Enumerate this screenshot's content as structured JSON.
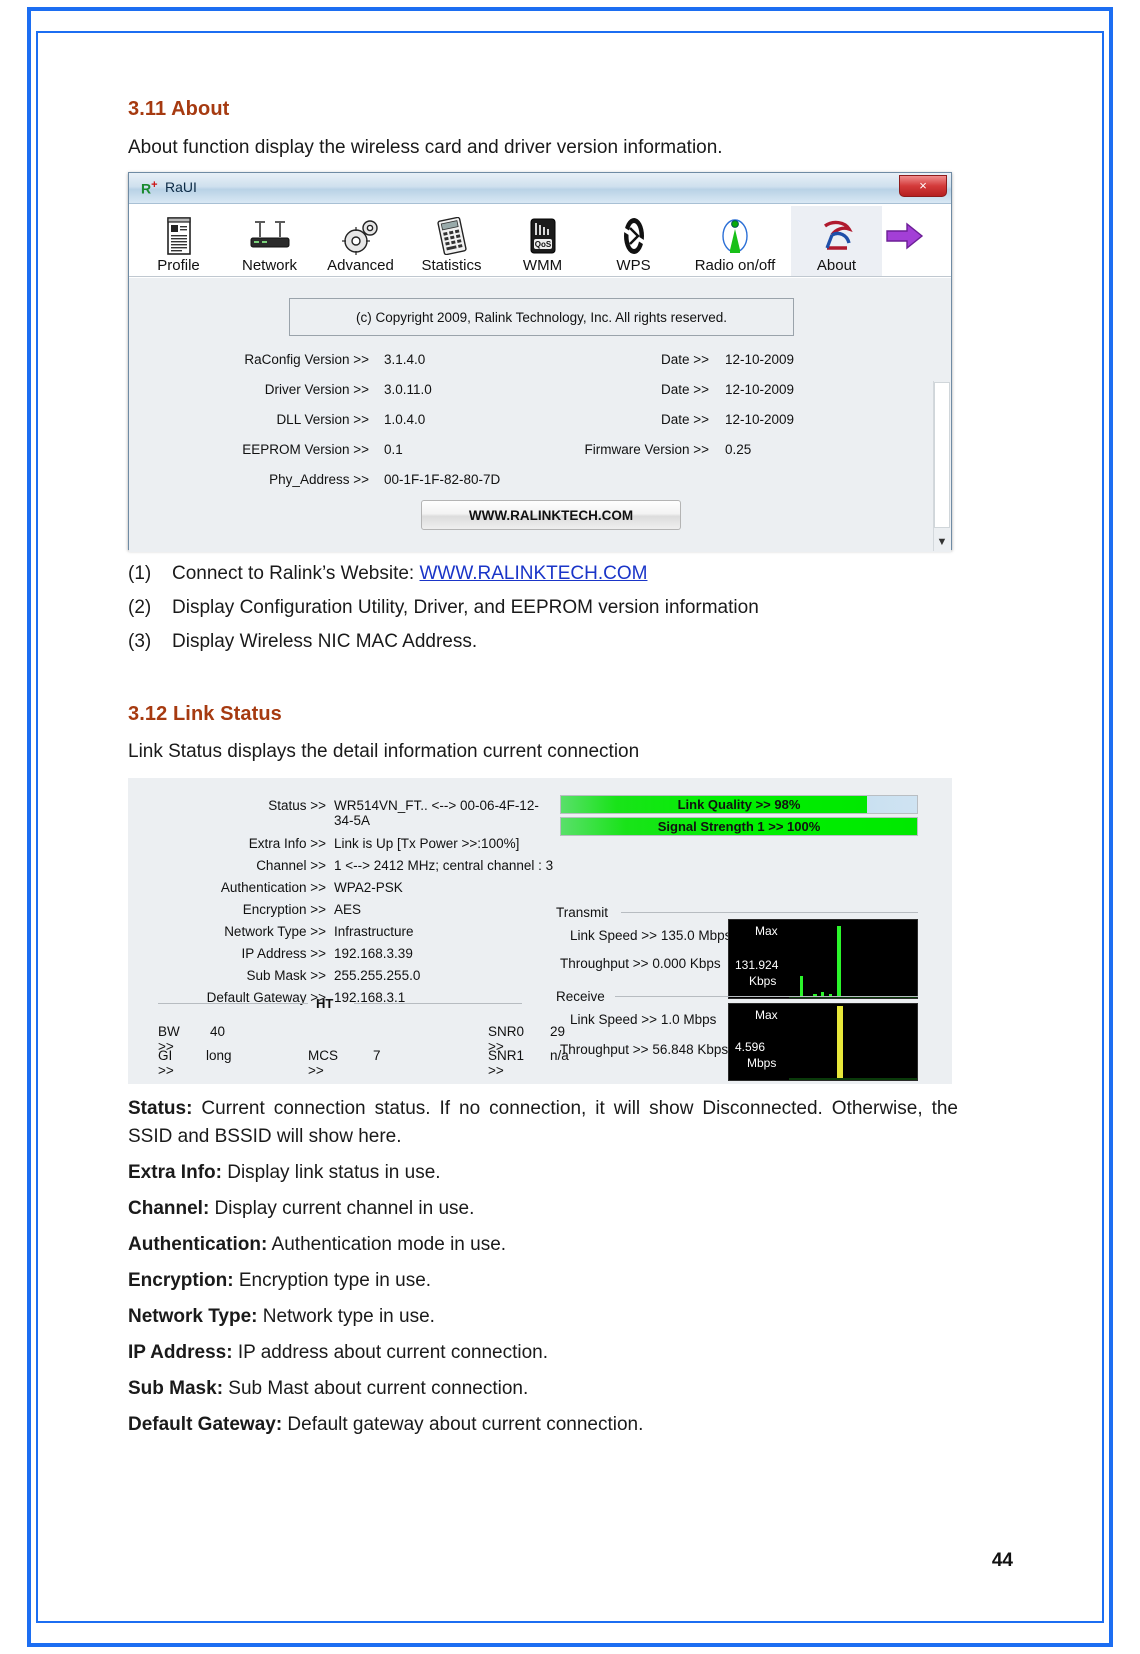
{
  "page": {
    "number": "44"
  },
  "section_about": {
    "heading": "3.11 About",
    "intro": "About function display the wireless card and driver version information.",
    "bullets": [
      {
        "num": "(1)",
        "text": "Connect to Ralink’s Website: ",
        "link": "WWW.RALINKTECH.COM"
      },
      {
        "num": "(2)",
        "text": "Display Configuration Utility, Driver, and EEPROM version information",
        "link": ""
      },
      {
        "num": "(3)",
        "text": "Display Wireless NIC MAC Address.",
        "link": ""
      }
    ]
  },
  "raui_window": {
    "title": "RaUI",
    "logo": "R",
    "logo_sup": "+",
    "close_label": "×",
    "toolbar": [
      {
        "label": "Profile",
        "icon": "profile-icon"
      },
      {
        "label": "Network",
        "icon": "network-icon"
      },
      {
        "label": "Advanced",
        "icon": "advanced-gear-icon"
      },
      {
        "label": "Statistics",
        "icon": "statistics-icon"
      },
      {
        "label": "WMM",
        "icon": "wmm-qos-icon"
      },
      {
        "label": "WPS",
        "icon": "wps-icon"
      },
      {
        "label": "Radio on/off",
        "icon": "radio-antenna-icon"
      },
      {
        "label": "About",
        "icon": "about-ralink-icon"
      }
    ],
    "next_arrow": "next-arrow-icon",
    "copyright": "(c) Copyright 2009, Ralink Technology, Inc.  All rights reserved.",
    "versions": [
      {
        "label": "RaConfig Version >>",
        "value": "3.1.4.0",
        "label2": "Date >>",
        "value2": "12-10-2009"
      },
      {
        "label": "Driver Version >>",
        "value": "3.0.11.0",
        "label2": "Date >>",
        "value2": "12-10-2009"
      },
      {
        "label": "DLL Version >>",
        "value": "1.0.4.0",
        "label2": "Date >>",
        "value2": "12-10-2009"
      },
      {
        "label": "EEPROM Version >>",
        "value": "0.1",
        "label2": "Firmware Version >>",
        "value2": "0.25"
      },
      {
        "label": "Phy_Address >>",
        "value": "00-1F-1F-82-80-7D",
        "label2": "",
        "value2": ""
      }
    ],
    "website_button": "WWW.RALINKTECH.COM",
    "scroll_down_icon": "▼"
  },
  "section_link_status": {
    "heading": "3.12 Link Status",
    "intro": "Link Status displays the detail information current connection"
  },
  "link_status_panel": {
    "left_fields": [
      {
        "label": "Status >>",
        "value": "WR514VN_FT.. <--> 00-06-4F-12-34-5A"
      },
      {
        "label": "Extra Info >>",
        "value": "Link is Up [Tx Power >>:100%]"
      },
      {
        "label": "Channel >>",
        "value": "1 <--> 2412 MHz; central channel : 3"
      },
      {
        "label": "Authentication >>",
        "value": "WPA2-PSK"
      },
      {
        "label": "Encryption >>",
        "value": "AES"
      },
      {
        "label": "Network Type >>",
        "value": "Infrastructure"
      },
      {
        "label": "IP Address >>",
        "value": "192.168.3.39"
      },
      {
        "label": "Sub Mask >>",
        "value": "255.255.255.0"
      },
      {
        "label": "Default Gateway >>",
        "value": "192.168.3.1"
      }
    ],
    "ht_caption": "HT",
    "ht_fields": {
      "bw_label": "BW >>",
      "bw_value": "40",
      "gi_label": "GI >>",
      "gi_value": "long",
      "mcs_label": "MCS >>",
      "mcs_value": "7",
      "snr0_label": "SNR0 >>",
      "snr0_value": "29",
      "snr1_label": "SNR1 >>",
      "snr1_value": "n/a"
    },
    "meters": [
      {
        "label": "Link Quality >> 98%",
        "percent": 98
      },
      {
        "label": "Signal Strength 1 >> 100%",
        "percent": 100
      }
    ],
    "transmit": {
      "caption": "Transmit",
      "link_speed": "Link Speed >>  135.0 Mbps",
      "throughput": "Throughput >> 0.000 Kbps",
      "graph_max": "Max",
      "graph_value": "131.924",
      "graph_unit": "Kbps"
    },
    "receive": {
      "caption": "Receive",
      "link_speed": "Link Speed >> 1.0 Mbps",
      "throughput": "Throughput >> 56.848 Kbps",
      "graph_max": "Max",
      "graph_value": "4.596",
      "graph_unit": "Mbps"
    }
  },
  "definitions": [
    {
      "term": "Status:",
      "desc": " Current connection status. If no connection, it will show Disconnected. Otherwise, the SSID and BSSID will show here."
    },
    {
      "term": "Extra Info:",
      "desc": " Display link status in use."
    },
    {
      "term": "Channel:",
      "desc": " Display current channel in use."
    },
    {
      "term": "Authentication:",
      "desc": " Authentication mode in use."
    },
    {
      "term": "Encryption:",
      "desc": " Encryption type in use."
    },
    {
      "term": "Network Type:",
      "desc": " Network type in use."
    },
    {
      "term": "IP Address:",
      "desc": " IP address about current connection."
    },
    {
      "term": "Sub Mask:",
      "desc": " Sub Mast about current connection."
    },
    {
      "term": "Default Gateway:",
      "desc": " Default gateway about current connection."
    }
  ],
  "colors": {
    "heading": "#a63a10",
    "link": "#1a35c8",
    "border": "#1c6ef2",
    "meter_green": "#00e800"
  }
}
